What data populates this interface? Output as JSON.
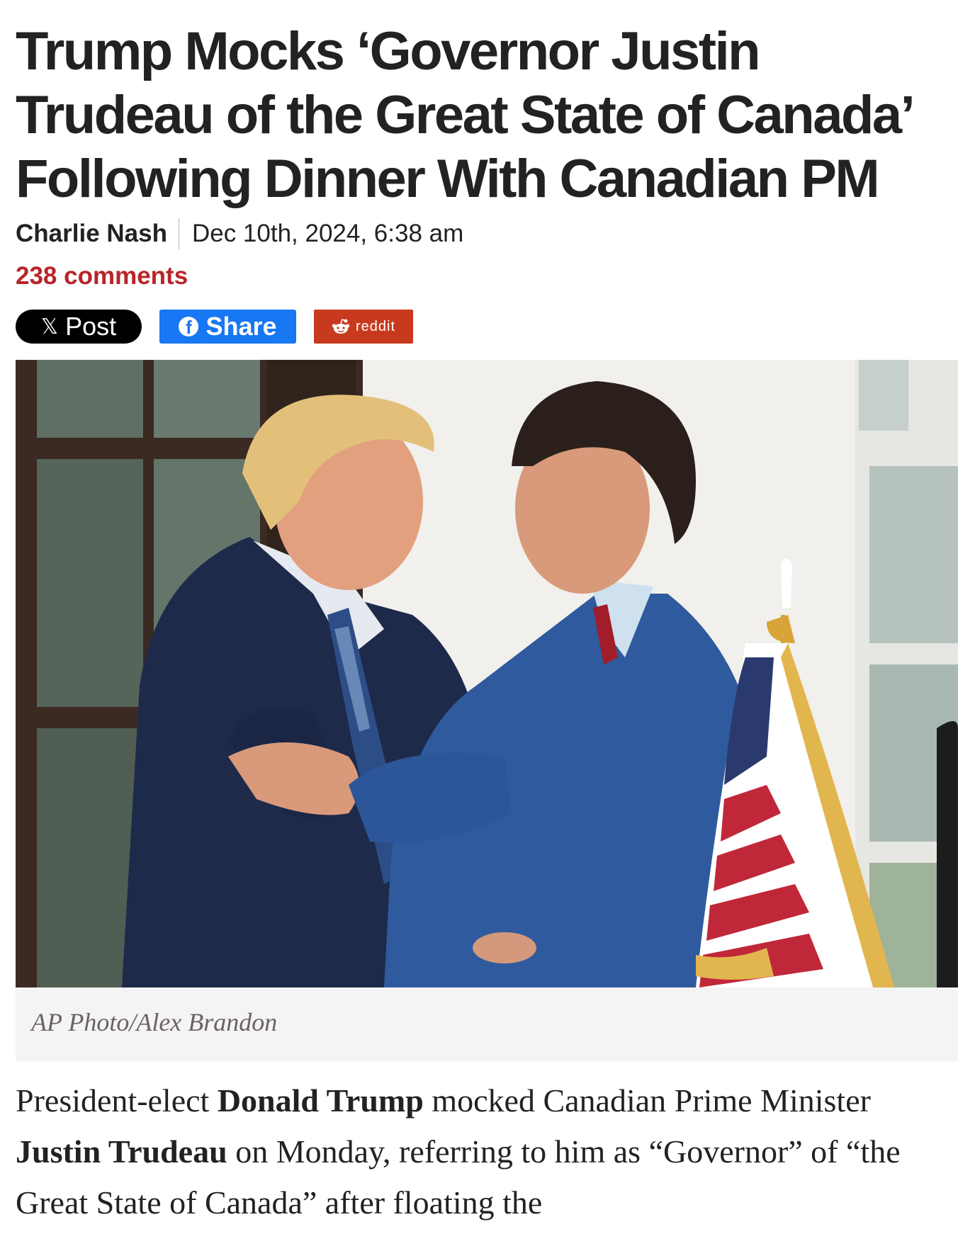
{
  "article": {
    "headline": "Trump Mocks ‘Governor Justin Trudeau of the Great State of Canada’ Following Dinner With Canadian PM",
    "author": "Charlie Nash",
    "date": "Dec 10th, 2024, 6:38 am",
    "comments_label": "238 comments"
  },
  "share": {
    "x_label": "Post",
    "x_icon": "x-logo-icon",
    "facebook_label": "Share",
    "facebook_icon": "facebook-icon",
    "reddit_label": "reddit",
    "reddit_icon": "reddit-alien-icon",
    "colors": {
      "x": "#000000",
      "facebook": "#1877f2",
      "reddit": "#c83a1e"
    }
  },
  "photo": {
    "caption": "AP Photo/Alex Brandon"
  },
  "body": {
    "p1_a": "President-elect ",
    "p1_b": "Donald Trump",
    "p1_c": " mocked Canadian Prime Minister ",
    "p1_d": "Justin Trudeau",
    "p1_e": " on Monday, referring to him as “Governor” of “the Great State of Canada” after floating the"
  },
  "colors": {
    "comments": "#b7252a",
    "caption_bg": "#f4f4f4"
  }
}
